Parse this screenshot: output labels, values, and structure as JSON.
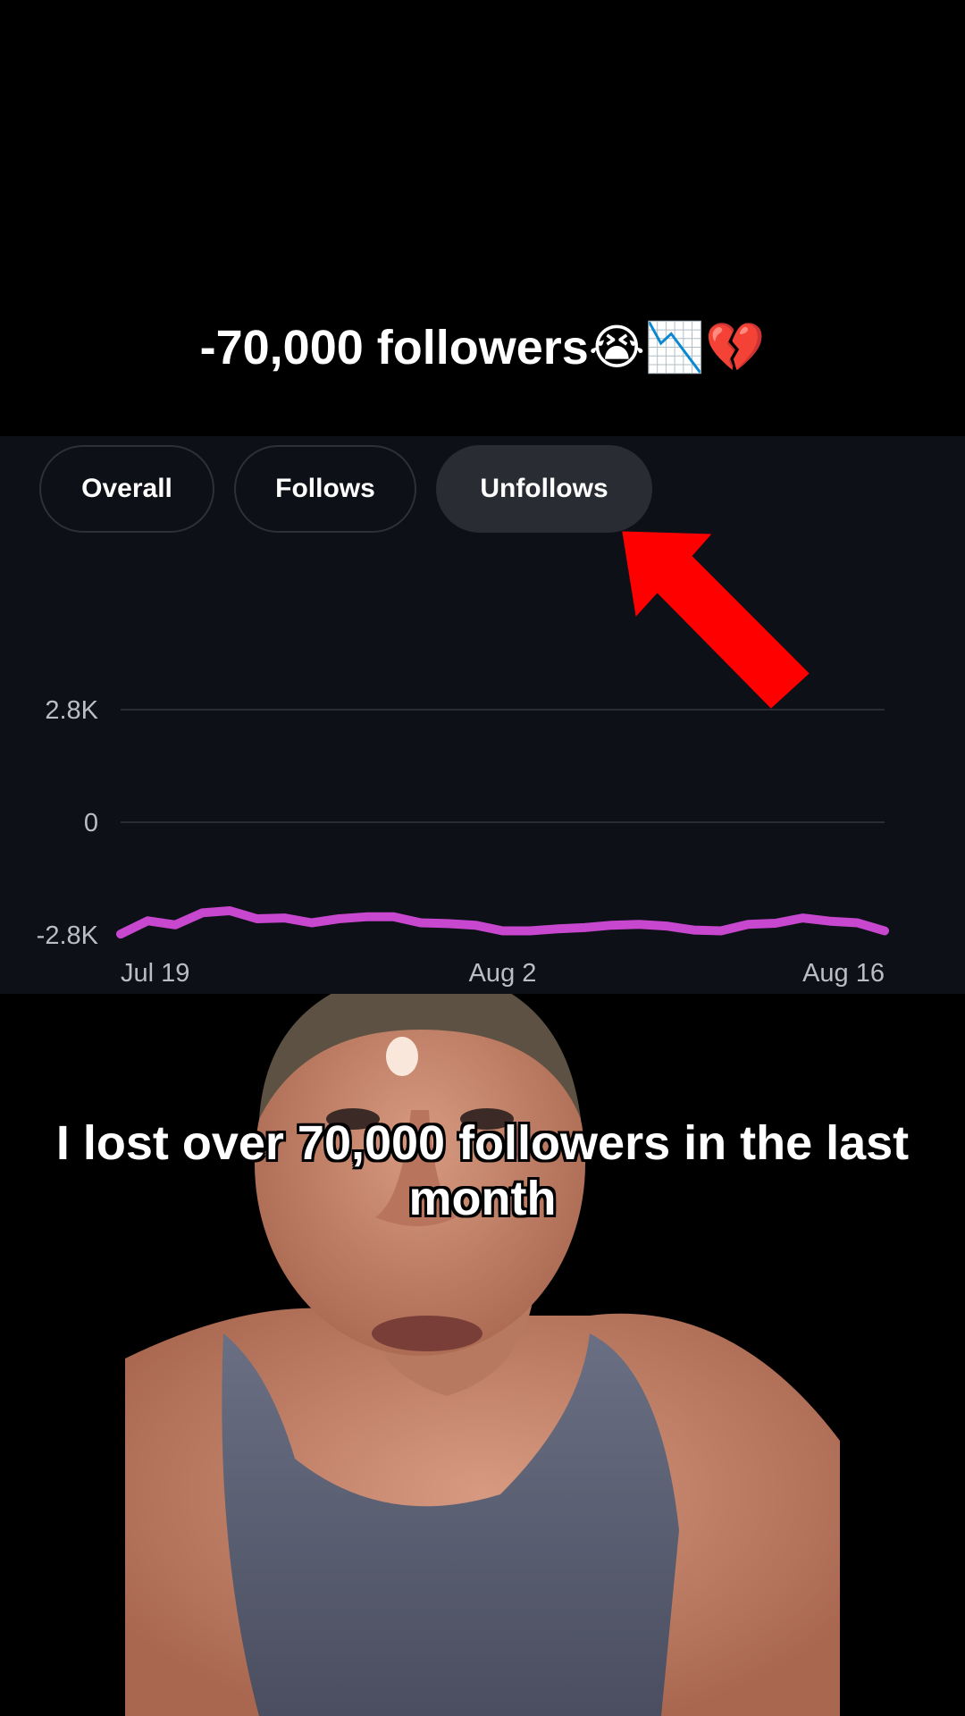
{
  "headline": "-70,000 followers😭📉💔",
  "tabs": [
    {
      "label": "Overall",
      "selected": false
    },
    {
      "label": "Follows",
      "selected": false
    },
    {
      "label": "Unfollows",
      "selected": true
    }
  ],
  "chart_data": {
    "type": "line",
    "x_ticks": [
      "Jul 19",
      "Aug 2",
      "Aug 16"
    ],
    "y_ticks": [
      "2.8K",
      "0",
      "-2.8K"
    ],
    "ylim": [
      -2800,
      2800
    ],
    "series": [
      {
        "color": "#c847cf",
        "x": [
          "Jul 19",
          "Jul 20",
          "Jul 21",
          "Jul 22",
          "Jul 23",
          "Jul 24",
          "Jul 25",
          "Jul 26",
          "Jul 27",
          "Jul 28",
          "Jul 29",
          "Jul 30",
          "Jul 31",
          "Aug 1",
          "Aug 2",
          "Aug 3",
          "Aug 4",
          "Aug 5",
          "Aug 6",
          "Aug 7",
          "Aug 8",
          "Aug 9",
          "Aug 10",
          "Aug 11",
          "Aug 12",
          "Aug 13",
          "Aug 14",
          "Aug 15",
          "Aug 16"
        ],
        "values": [
          -2780,
          -2450,
          -2550,
          -2250,
          -2200,
          -2400,
          -2380,
          -2500,
          -2400,
          -2350,
          -2350,
          -2500,
          -2520,
          -2560,
          -2700,
          -2700,
          -2650,
          -2620,
          -2560,
          -2540,
          -2580,
          -2680,
          -2700,
          -2540,
          -2510,
          -2380,
          -2460,
          -2500,
          -2700
        ]
      }
    ],
    "grid": true
  },
  "annotation": {
    "arrow_color": "#ff0000"
  },
  "caption": "I lost over 70,000 followers in the last month"
}
